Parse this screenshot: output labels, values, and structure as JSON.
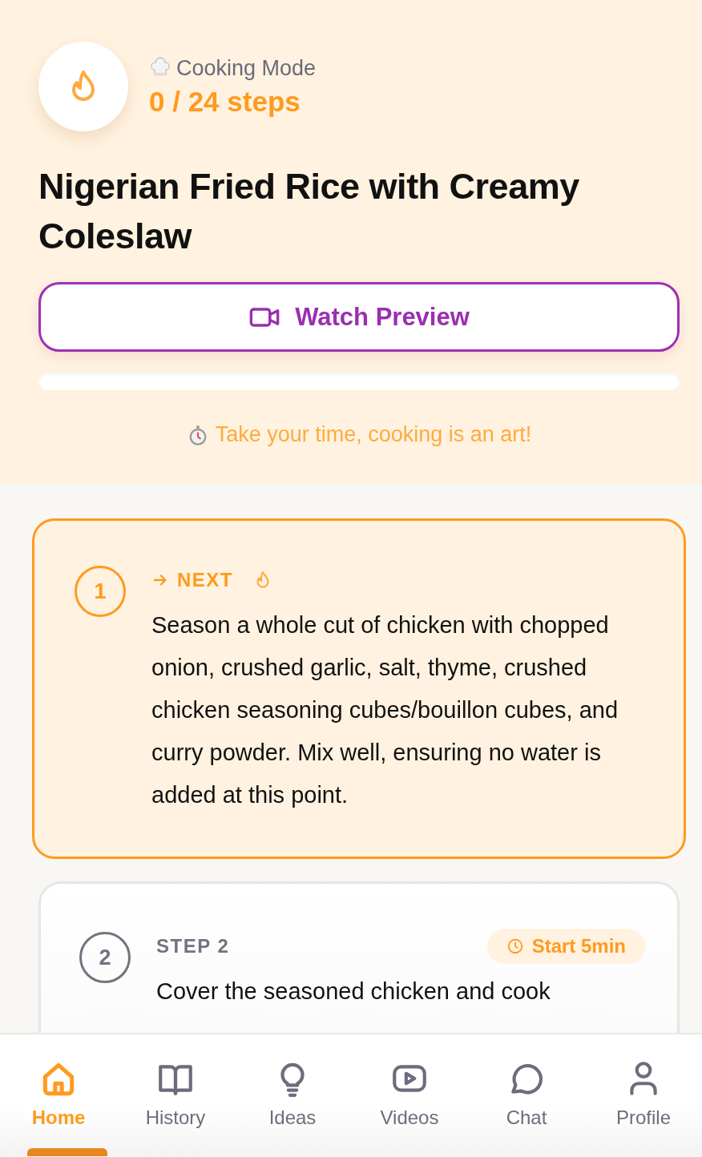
{
  "header": {
    "mode_label": "Cooking Mode",
    "progress_text": "0 / 24 steps",
    "title": "Nigerian Fried Rice with Creamy Coleslaw",
    "preview_button": "Watch Preview",
    "progress": {
      "level": 0
    },
    "tip": "Take your time, cooking is an art!"
  },
  "steps": [
    {
      "number": "1",
      "label": "NEXT",
      "current": true,
      "text": "Season a whole cut of chicken with chopped onion, crushed garlic, salt, thyme, crushed chicken seasoning cubes/bouillon cubes, and curry powder. Mix well, ensuring no water is added at this point."
    },
    {
      "number": "2",
      "label": "STEP 2",
      "current": false,
      "timer": "Start 5min",
      "text": "Cover the seasoned chicken and cook"
    }
  ],
  "nav": [
    {
      "label": "Home",
      "kind": "home",
      "selected": true
    },
    {
      "label": "History",
      "kind": "book",
      "selected": false
    },
    {
      "label": "Ideas",
      "kind": "bulb",
      "selected": false
    },
    {
      "label": "Videos",
      "kind": "play",
      "selected": false
    },
    {
      "label": "Chat",
      "kind": "chat",
      "selected": false
    },
    {
      "label": "Profile",
      "kind": "user",
      "selected": false
    }
  ]
}
